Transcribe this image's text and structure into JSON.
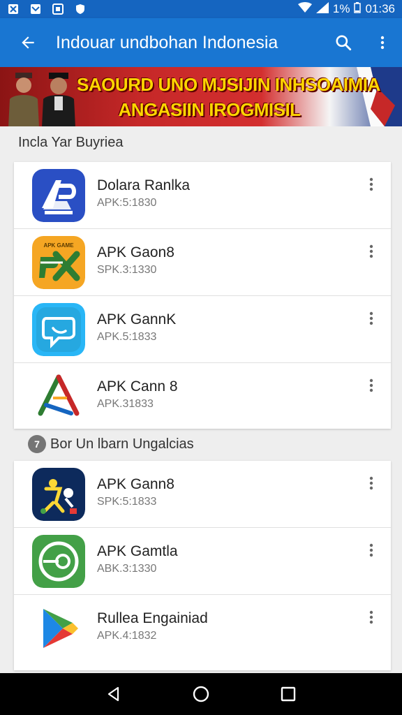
{
  "status_bar": {
    "battery": "1%",
    "time": "01:36"
  },
  "app_bar": {
    "title": "Indouar undbohan Indonesia"
  },
  "banner": {
    "line1": "SAOURD UNO MJSIJIN INHSOAIMIA",
    "line2": "ANGASIIN IROGMISIL"
  },
  "section1": {
    "title": "Incla Yar Buyriea",
    "apps": [
      {
        "name": "Dolara Ranlka",
        "sub": "APK:5:1830",
        "icon": "ap-logo-icon"
      },
      {
        "name": "APK Gaon8",
        "sub": "SPK.3:1330",
        "icon": "px-logo-icon"
      },
      {
        "name": "APK GannK",
        "sub": "APK.5:1833",
        "icon": "chat-bubble-icon"
      },
      {
        "name": "APK Cann 8",
        "sub": "APK.31833",
        "icon": "triangle-logo-icon"
      }
    ]
  },
  "section2": {
    "badge": "7",
    "title": "Bor Un lbarn Ungalcias",
    "apps": [
      {
        "name": "APK Gann8",
        "sub": "SPK:5:1833",
        "icon": "game-figure-icon"
      },
      {
        "name": "APK Gamtla",
        "sub": "ABK.3:1330",
        "icon": "green-circle-icon"
      },
      {
        "name": "Rullea Engainiad",
        "sub": "APK.4:1832",
        "icon": "play-store-icon"
      }
    ]
  },
  "colors": {
    "status_bar": "#1565c0",
    "app_bar": "#1976d2",
    "banner_text": "#ffd600"
  }
}
